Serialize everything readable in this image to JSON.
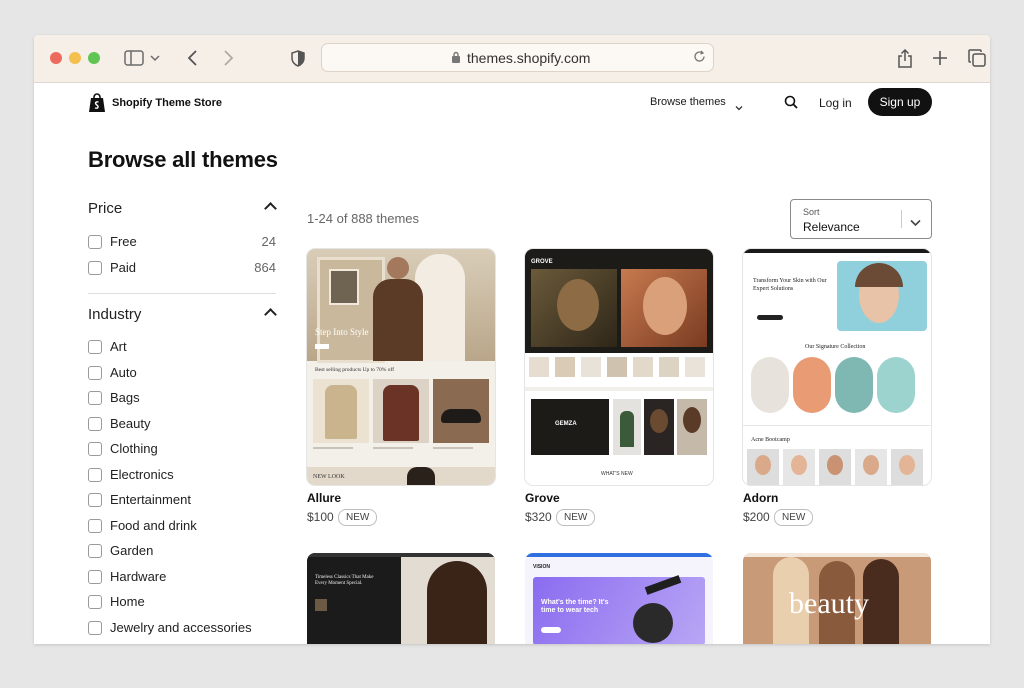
{
  "browser": {
    "url": "themes.shopify.com"
  },
  "header": {
    "brand": "Shopify Theme Store",
    "browse_themes": "Browse themes",
    "login": "Log in",
    "signup": "Sign up"
  },
  "page": {
    "title": "Browse all themes",
    "results_count": "1-24 of 888 themes"
  },
  "sort": {
    "label": "Sort",
    "value": "Relevance"
  },
  "filters": {
    "price": {
      "title": "Price",
      "options": [
        {
          "label": "Free",
          "count": "24"
        },
        {
          "label": "Paid",
          "count": "864"
        }
      ]
    },
    "industry": {
      "title": "Industry",
      "options": [
        {
          "label": "Art"
        },
        {
          "label": "Auto"
        },
        {
          "label": "Bags"
        },
        {
          "label": "Beauty"
        },
        {
          "label": "Clothing"
        },
        {
          "label": "Electronics"
        },
        {
          "label": "Entertainment"
        },
        {
          "label": "Food and drink"
        },
        {
          "label": "Garden"
        },
        {
          "label": "Hardware"
        },
        {
          "label": "Home"
        },
        {
          "label": "Jewelry and accessories"
        }
      ]
    }
  },
  "themes": [
    {
      "name": "Allure",
      "price": "$100",
      "badge": "NEW",
      "preview_text": [
        "Step Into Style",
        "Best selling products Up to 70% off",
        "NEW LOOK"
      ]
    },
    {
      "name": "Grove",
      "price": "$320",
      "badge": "NEW",
      "preview_text": [
        "GROVE",
        "GEMZA",
        "WHAT'S NEW"
      ]
    },
    {
      "name": "Adorn",
      "price": "$200",
      "badge": "NEW",
      "preview_text": [
        "Transform Your Skin with Our Expert Solutions",
        "Our Signature Collection",
        "Acne Bootcamp"
      ]
    }
  ],
  "more_themes": [
    {
      "preview_text": "Timeless Classics That Make Every Moment Special."
    },
    {
      "preview_text": "What's the time? It's time to wear tech",
      "brand": "VISION"
    },
    {
      "preview_text": "beauty"
    }
  ],
  "colors": {
    "browser_chrome": "#f6efe7",
    "primary_button": "#111111",
    "vision_blue": "#2f6fe0",
    "vision_purple": "#8a6cf0"
  }
}
